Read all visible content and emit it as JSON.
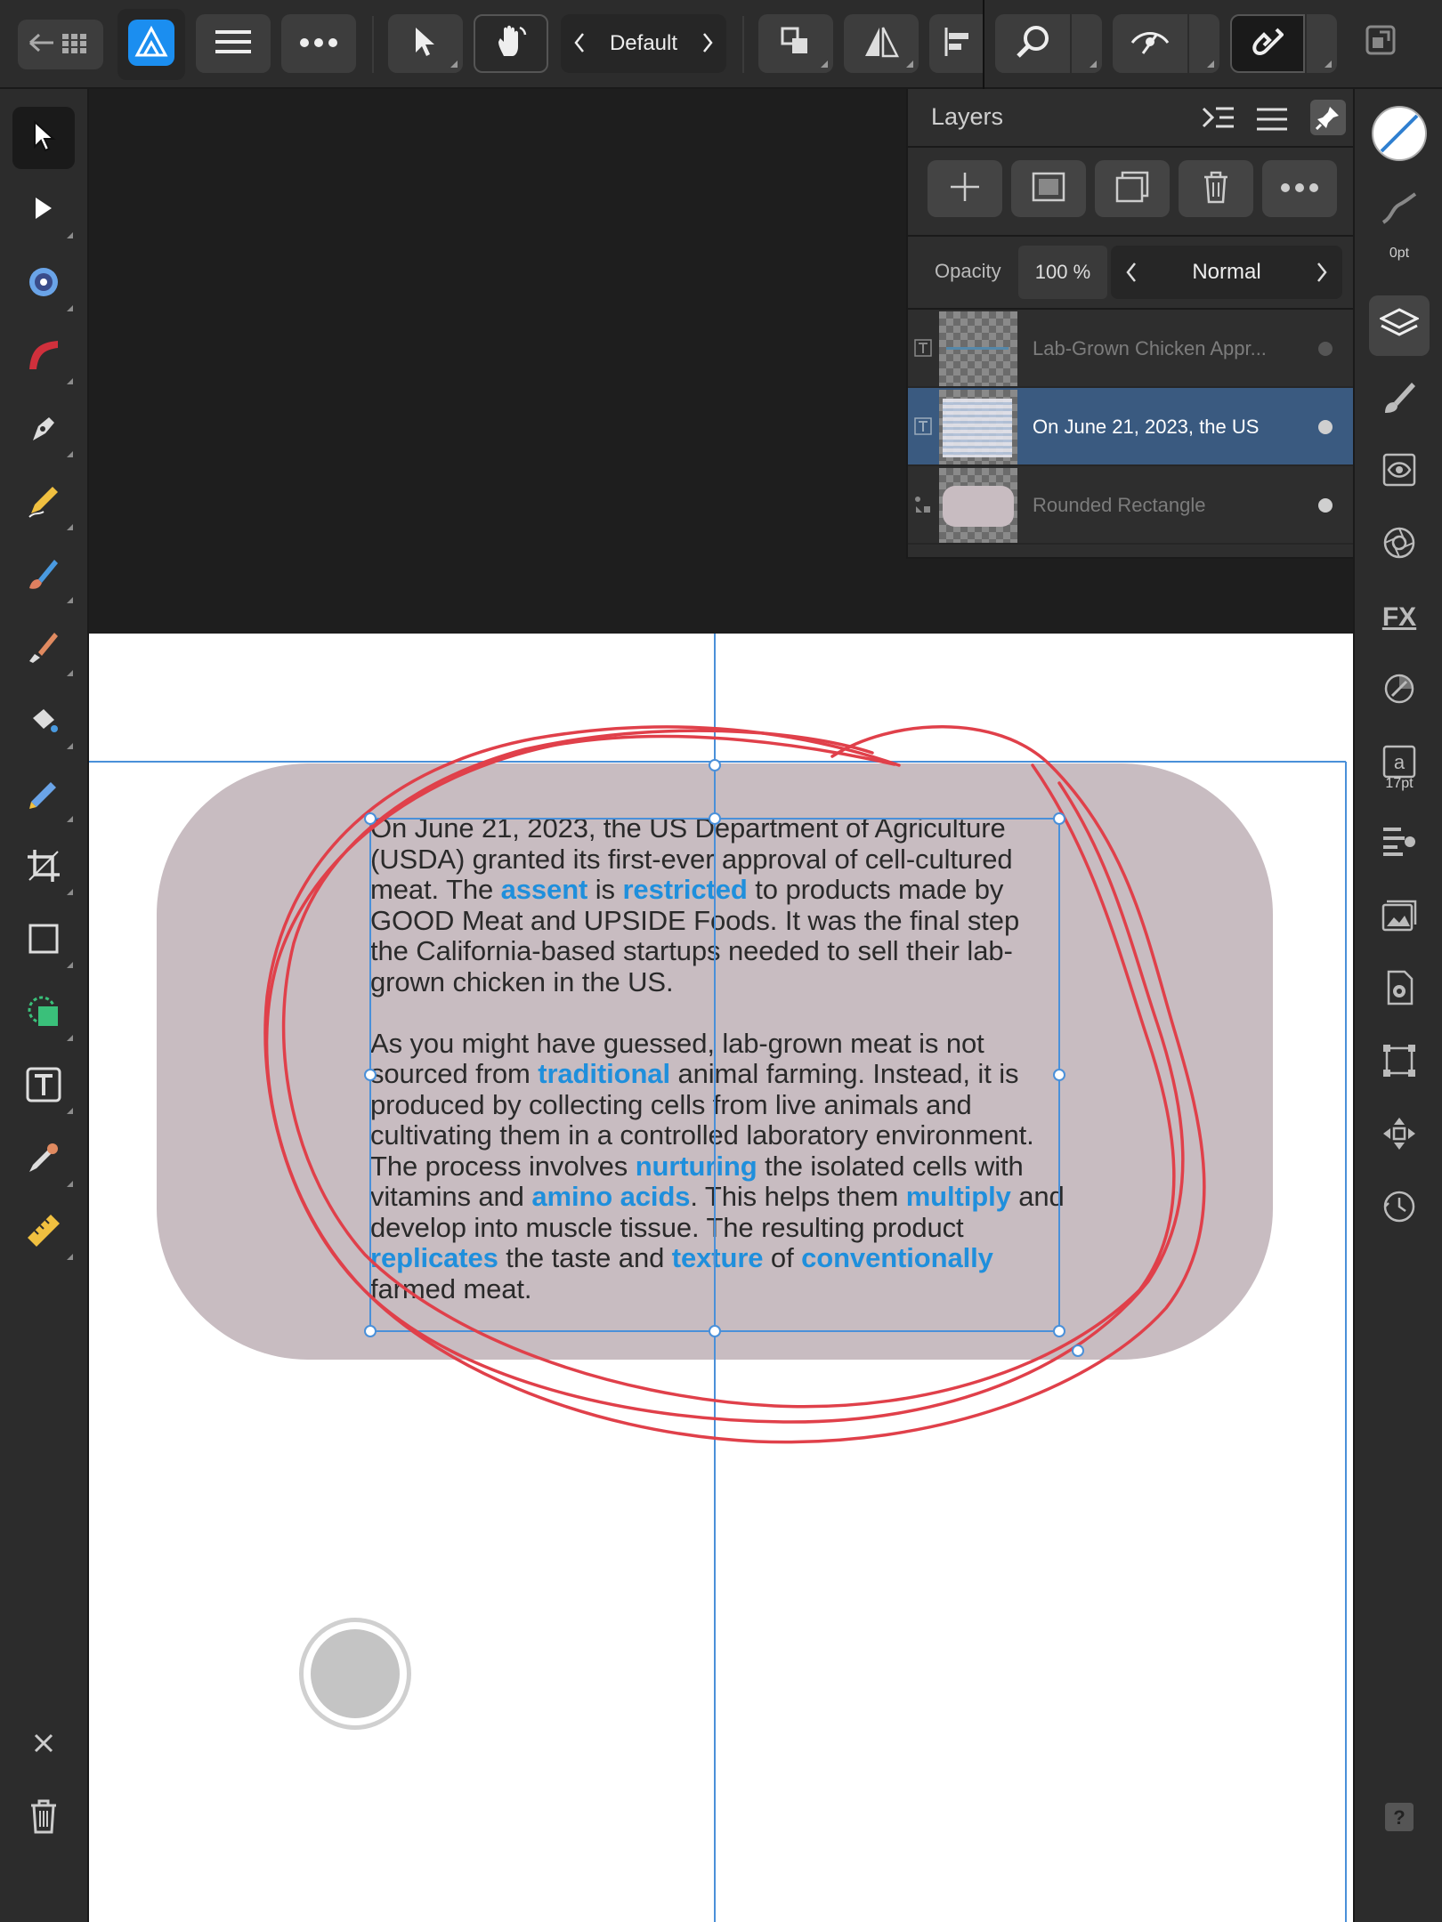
{
  "top_toolbar": {
    "back_icon": "back-to-gallery-icon",
    "app_icon": "affinity-designer-logo",
    "menu_icon": "hamburger-menu-icon",
    "more_icon": "more-icon",
    "move_icon": "move-tool-icon",
    "touch_icon": "touch-gesture-icon",
    "workspace_label": "Default",
    "arrange_icon": "arrange-icon",
    "flip_icon": "flip-icon",
    "align_icon": "align-icon",
    "zoom_icon": "zoom-icon",
    "view_icon": "view-mode-icon",
    "snapping_icon": "snapping-icon",
    "fullscreen_icon": "fullscreen-icon"
  },
  "layers_panel": {
    "title": "Layers",
    "opacity_label": "Opacity",
    "opacity_value": "100 %",
    "blend_mode": "Normal",
    "layers": [
      {
        "name": "Lab-Grown Chicken Appr...",
        "type": "text",
        "selected": false
      },
      {
        "name": "On June 21, 2023, the US",
        "type": "text",
        "selected": true
      },
      {
        "name": "Rounded Rectangle",
        "type": "shape",
        "selected": false
      }
    ]
  },
  "right_toolbar": {
    "stroke_width": "0pt",
    "font_size": "17pt"
  },
  "document": {
    "paragraph1": [
      {
        "t": "On June 21, 2023, the US Department of Agriculture (USDA) granted its first-ever approval of cell-cultured meat. The "
      },
      {
        "t": "assent",
        "hl": true
      },
      {
        "t": " is "
      },
      {
        "t": "restricted",
        "hl": true
      },
      {
        "t": " to products made by GOOD Meat and UPSIDE Foods. It was the final step the California-based startups needed to sell their lab-grown chicken in the US."
      }
    ],
    "paragraph2": [
      {
        "t": "As you might have guessed, lab-grown meat is not sourced from "
      },
      {
        "t": "traditional",
        "hl": true
      },
      {
        "t": " animal farming. Instead, it is produced by collecting cells from live animals and cultivating them in a controlled laboratory environment. The process involves "
      },
      {
        "t": "nurturing",
        "hl": true
      },
      {
        "t": " the isolated cells with vitamins and "
      },
      {
        "t": "amino acids",
        "hl": true
      },
      {
        "t": ". This helps them "
      },
      {
        "t": "multiply",
        "hl": true
      },
      {
        "t": " and develop into muscle tissue. The resulting product "
      },
      {
        "t": "replicates",
        "hl": true
      },
      {
        "t": " the taste and "
      },
      {
        "t": "texture",
        "hl": true
      },
      {
        "t": " of "
      },
      {
        "t": "conventionally",
        "hl": true
      },
      {
        "t": " farmed meat."
      }
    ]
  },
  "colors": {
    "accent": "#1f8fdc",
    "selected_layer": "#3a5a80",
    "rounded_rect_fill": "#c8bcc1",
    "annotation_red": "#e0404a",
    "guide_blue": "#4a90d9"
  }
}
